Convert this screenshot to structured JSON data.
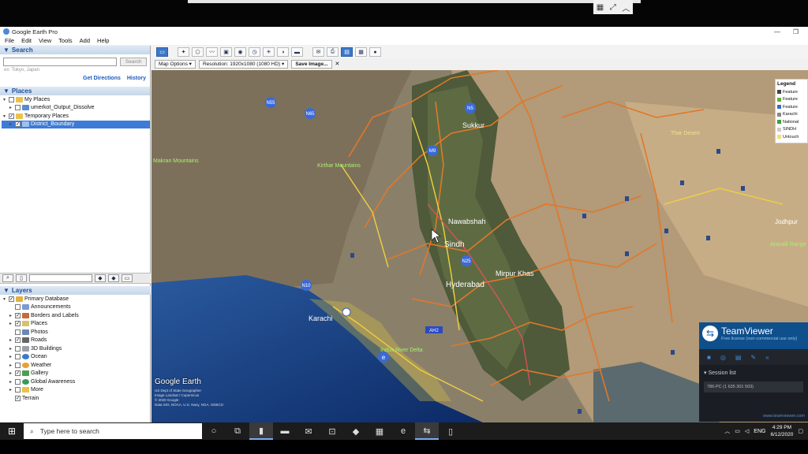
{
  "window": {
    "title": "Google Earth Pro"
  },
  "menu": [
    "File",
    "Edit",
    "View",
    "Tools",
    "Add",
    "Help"
  ],
  "search": {
    "header": "Search",
    "placeholder": "",
    "button": "Search",
    "hint": "ex: Tokyo, Japan",
    "get_directions": "Get Directions",
    "history": "History"
  },
  "places": {
    "header": "Places",
    "items": [
      {
        "label": "My Places",
        "checked": false,
        "expanded": true
      },
      {
        "label": "umerkot_Output_Dissolve",
        "checked": false
      },
      {
        "label": "Temporary Places",
        "checked": true,
        "expanded": true
      },
      {
        "label": "District_Boundary",
        "checked": true,
        "selected": true
      }
    ]
  },
  "layers": {
    "header": "Layers",
    "items": [
      {
        "label": "Primary Database",
        "checked": true
      },
      {
        "label": "Announcements",
        "checked": false
      },
      {
        "label": "Borders and Labels",
        "checked": true
      },
      {
        "label": "Places",
        "checked": true
      },
      {
        "label": "Photos",
        "checked": false
      },
      {
        "label": "Roads",
        "checked": true
      },
      {
        "label": "3D Buildings",
        "checked": false
      },
      {
        "label": "Ocean",
        "checked": false
      },
      {
        "label": "Weather",
        "checked": false
      },
      {
        "label": "Gallery",
        "checked": true
      },
      {
        "label": "Global Awareness",
        "checked": false
      },
      {
        "label": "More",
        "checked": false
      },
      {
        "label": "Terrain",
        "checked": true
      }
    ]
  },
  "options": {
    "map_options": "Map Options",
    "resolution": "Resolution: 1920x1080 (1080 HD)",
    "save_image": "Save Image...",
    "close": "✕"
  },
  "map": {
    "labels": [
      "Sukkur",
      "Thar Desert",
      "Kirthar Mountains",
      "Makran Mountains",
      "Nawabshah",
      "Sindh",
      "Hyderabad",
      "Mirpur Khas",
      "Karachi",
      "Indus River Delta",
      "Jodhpur",
      "Aravalli Range"
    ],
    "shields": [
      "N55",
      "N65",
      "N5",
      "M9",
      "AH2",
      "N25",
      "N10"
    ],
    "logo": "Google Earth",
    "credits": [
      "US Dept of State Geographer",
      "Image Landsat / Copernicus",
      "© 2020 Google",
      "Data SIO, NOAA, U.S. Navy, NGA, GEBCO"
    ]
  },
  "legend": {
    "title": "Legend",
    "items": [
      {
        "label": "Feature",
        "color": "#444444"
      },
      {
        "label": "Feature",
        "color": "#6aaa3a"
      },
      {
        "label": "Feature",
        "color": "#3a6ac8"
      },
      {
        "label": "Karachi",
        "color": "#888888"
      },
      {
        "label": "National",
        "color": "#3aa03a"
      },
      {
        "label": "SINDH",
        "color": "#cccccc"
      },
      {
        "label": "Untouch",
        "color": "#f0e070"
      }
    ]
  },
  "teamviewer": {
    "title": "TeamViewer",
    "subtitle": "Free license (non-commercial use only)",
    "session_list": "Session list",
    "session_item": "786-PC (1 635 301 503)",
    "footer": "www.teamviewer.com"
  },
  "taskbar": {
    "search_placeholder": "Type here to search",
    "lang": "ENG",
    "time": "4:29 PM",
    "date": "6/12/2020"
  }
}
